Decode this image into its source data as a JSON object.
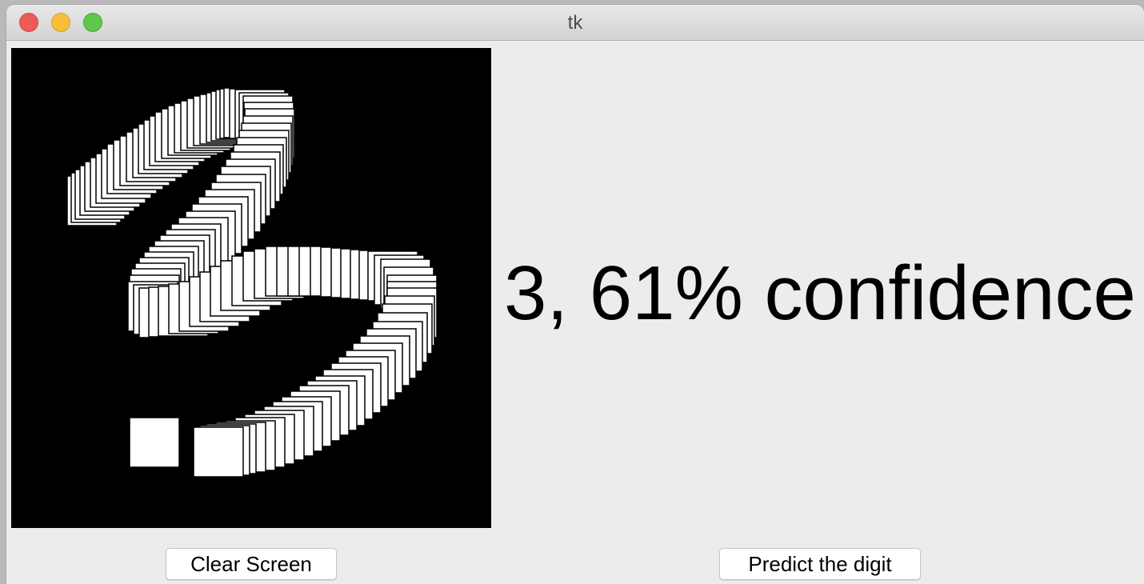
{
  "window": {
    "title": "tk"
  },
  "prediction": {
    "text": "3, 61% confidence"
  },
  "buttons": {
    "clear_label": "Clear Screen",
    "predict_label": "Predict the digit"
  },
  "colors": {
    "canvas_background": "#000000",
    "stroke": "#ffffff",
    "window_background": "#ececec"
  }
}
